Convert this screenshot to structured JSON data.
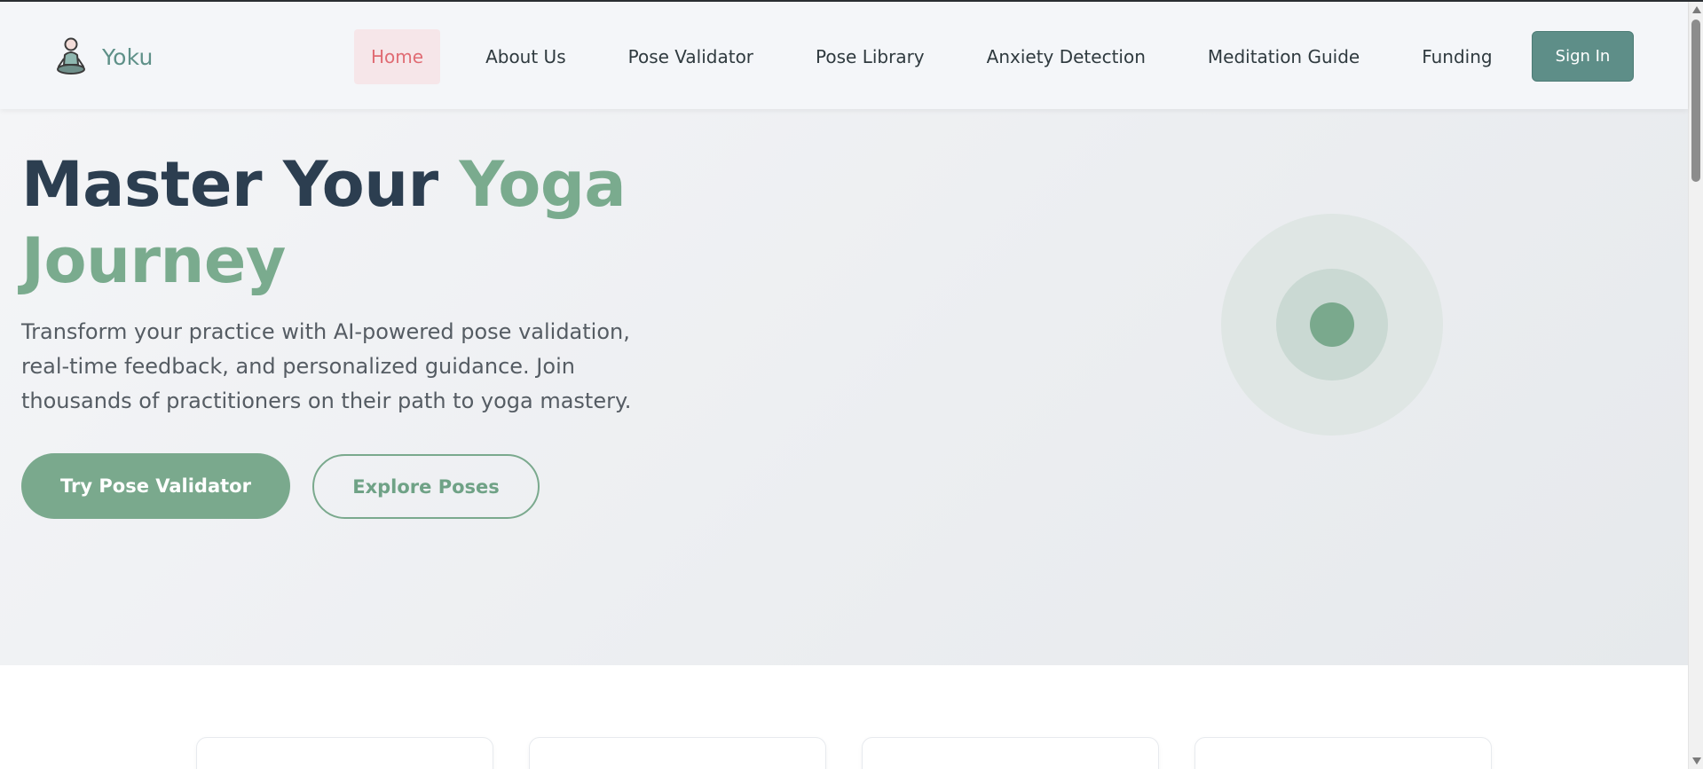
{
  "brand": {
    "name": "Yoku",
    "logo_icon": "meditating-person-icon"
  },
  "nav": {
    "items": [
      {
        "label": "Home",
        "active": true
      },
      {
        "label": "About Us",
        "active": false
      },
      {
        "label": "Pose Validator",
        "active": false
      },
      {
        "label": "Pose Library",
        "active": false
      },
      {
        "label": "Anxiety Detection",
        "active": false
      },
      {
        "label": "Meditation Guide",
        "active": false
      },
      {
        "label": "Funding",
        "active": false
      }
    ],
    "signin_label": "Sign In"
  },
  "hero": {
    "title_main": "Master Your ",
    "title_accent": "Yoga Journey",
    "subtitle": "Transform your practice with AI-powered pose validation, real-time feedback, and personalized guidance. Join thousands of practitioners on their path to yoga mastery.",
    "primary_button": "Try Pose Validator",
    "secondary_button": "Explore Poses",
    "graphic_icon": "target-circles-icon"
  },
  "colors": {
    "brand": "#5e9088",
    "accent": "#7aab8e",
    "active_nav_bg": "#f6e6e9",
    "active_nav_text": "#e06b73",
    "title": "#2c3e50",
    "signin_bg": "#5e8e88"
  }
}
